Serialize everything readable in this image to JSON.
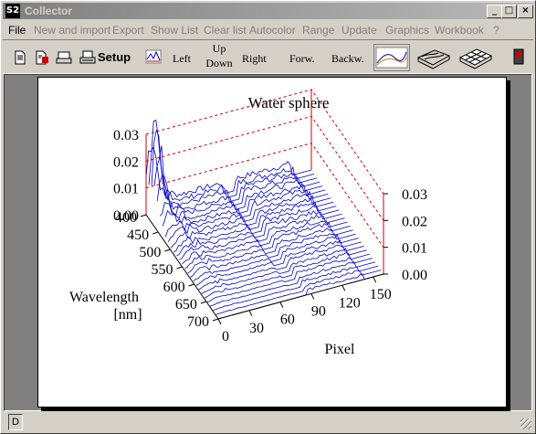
{
  "window": {
    "title": "Collector",
    "icon_text": "S2",
    "controls": {
      "minimize": "_",
      "maximize": "□",
      "close": "×"
    }
  },
  "menu": {
    "items": [
      "File",
      "New and import",
      "Export",
      "Show List",
      "Clear list",
      "Autocolor",
      "Range",
      "Update",
      "Graphics",
      "Workbook",
      "?"
    ]
  },
  "toolbar": {
    "setup_label": "Setup",
    "left_label": "Left",
    "up_label": "Up",
    "down_label": "Down",
    "right_label": "Right",
    "forward_label": "Forw.",
    "backward_label": "Backw.",
    "icons": [
      "new-document-icon",
      "import-document-icon",
      "print-preview-icon",
      "print-icon",
      "chart-type-icon",
      "line-graph-icon",
      "surface-graph-icon",
      "grid-surface-icon",
      "battery-icon"
    ]
  },
  "status": {
    "cell_text": "D"
  },
  "colors": {
    "surface_line": "#0000cc",
    "axis_red": "#cc0000",
    "desktop": "#808080"
  },
  "chart_data": {
    "type": "surface3d",
    "title": "Water sphere",
    "xlabel": "Pixel",
    "ylabel_line1": "Wavelength",
    "ylabel_line2": "[nm]",
    "x_ticks": [
      "0",
      "30",
      "60",
      "90",
      "120",
      "150"
    ],
    "y_ticks": [
      "400",
      "450",
      "500",
      "550",
      "600",
      "650",
      "700"
    ],
    "z_ticks_left": [
      "0.03",
      "0.02",
      "0.01",
      "0.00"
    ],
    "z_ticks_right": [
      "0.03",
      "0.02",
      "0.01",
      "0.00"
    ],
    "xlim": [
      0,
      160
    ],
    "ylim": [
      400,
      700
    ],
    "zlim": [
      0,
      0.03
    ]
  }
}
